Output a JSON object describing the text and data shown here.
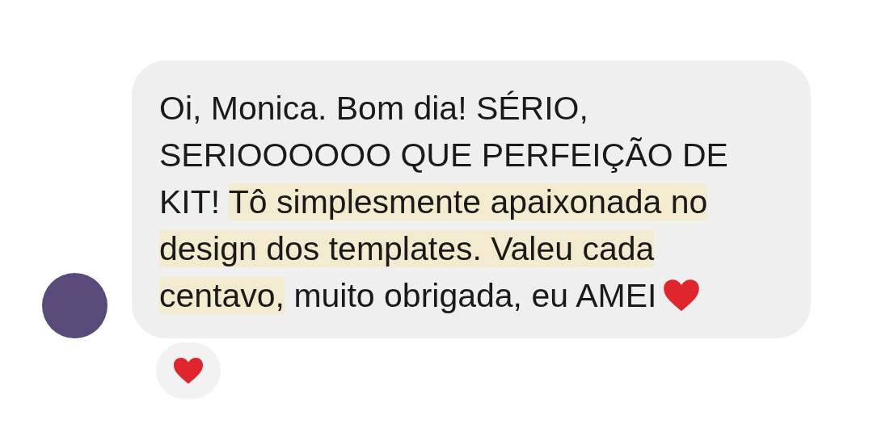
{
  "message": {
    "segments": [
      {
        "text": "Oi, Monica. Bom dia! SÉRIO, SERIOOOOOO QUE PERFEIÇÃO DE KIT! ",
        "highlighted": false
      },
      {
        "text": "Tô simplesmente apaixonada no design dos templates. Valeu cada centavo,",
        "highlighted": true
      },
      {
        "text": " muito obrigada, eu AMEI",
        "highlighted": false
      }
    ],
    "ends_with_heart": true
  },
  "reaction": {
    "kind": "heart"
  }
}
